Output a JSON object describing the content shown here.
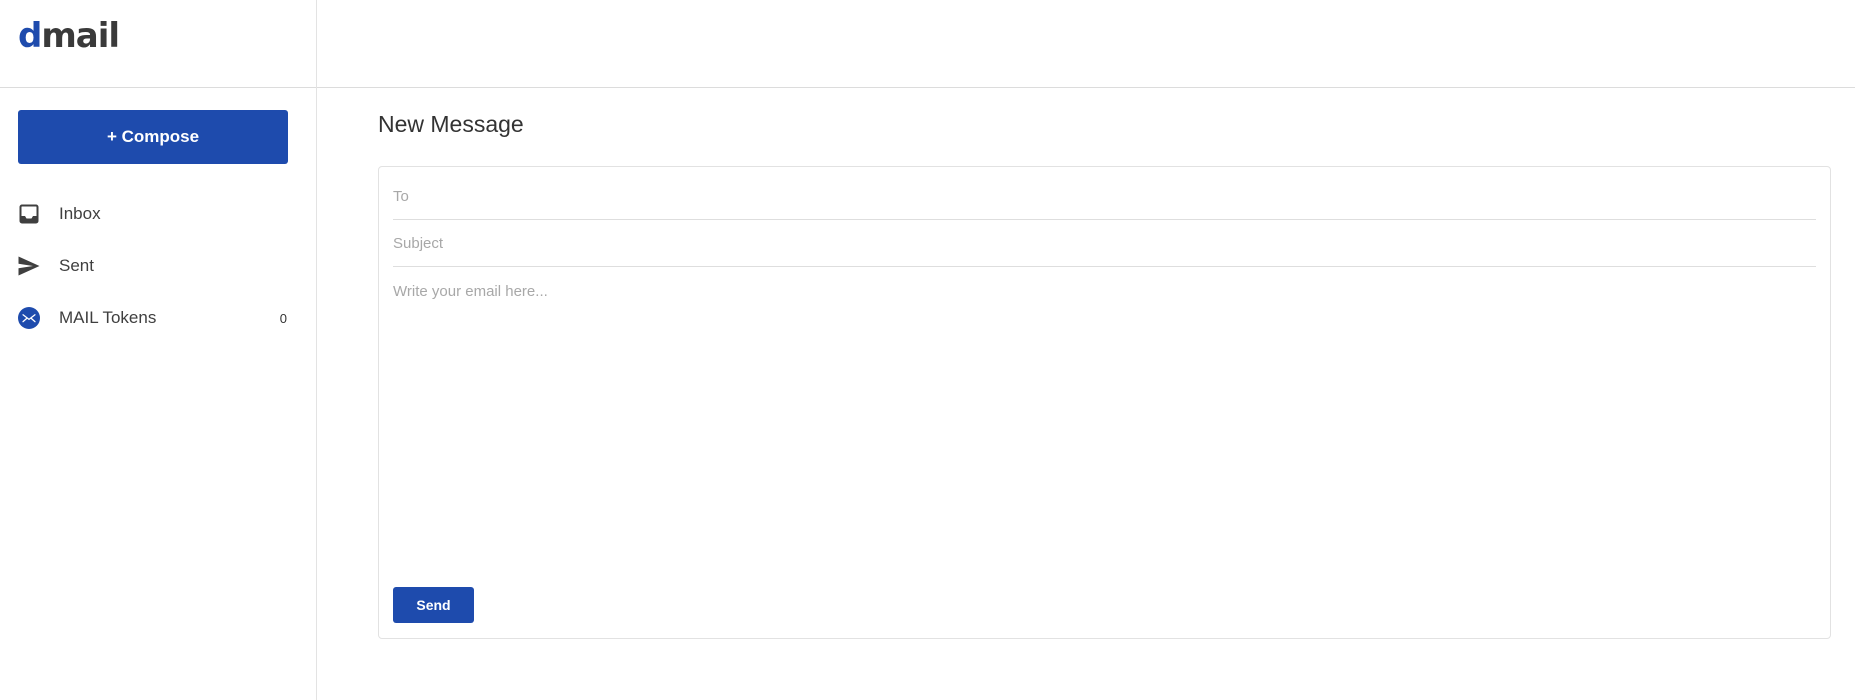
{
  "app": {
    "logo_first_letter": "d",
    "logo_rest": "mail",
    "brand_color": "#1e4bad"
  },
  "sidebar": {
    "compose_label": "+ Compose",
    "items": [
      {
        "label": "Inbox",
        "icon": "inbox-icon"
      },
      {
        "label": "Sent",
        "icon": "send-icon"
      },
      {
        "label": "MAIL Tokens",
        "icon": "mail-token-icon",
        "count": "0"
      }
    ]
  },
  "main": {
    "title": "New Message",
    "to_placeholder": "To",
    "subject_placeholder": "Subject",
    "body_placeholder": "Write your email here...",
    "send_label": "Send"
  }
}
